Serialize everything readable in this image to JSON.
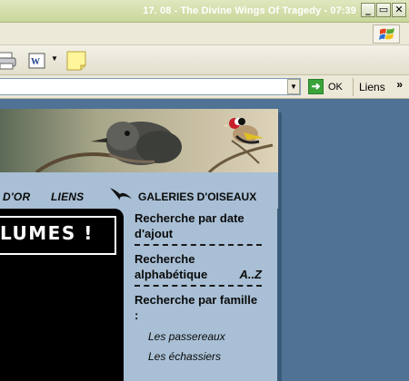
{
  "window": {
    "title": "17. 08 - The Divine Wings Of Tragedy - 07:39",
    "minimize": "_",
    "maximize": "▭",
    "close": "✕"
  },
  "address": {
    "go_label": "OK",
    "links_label": "Liens",
    "more": "»"
  },
  "site": {
    "nav": {
      "item1": "D'OR",
      "item2": "LIENS",
      "gallery": "GALERIES D'OISEAUX"
    },
    "headline": "LUMES !",
    "sidebar": {
      "search_date": "Recherche par date d'ajout",
      "search_alpha": "Recherche alphabétique",
      "az": "A..Z",
      "search_family": "Recherche par famille :",
      "families": [
        "Les passereaux",
        "Les échassiers"
      ]
    }
  }
}
